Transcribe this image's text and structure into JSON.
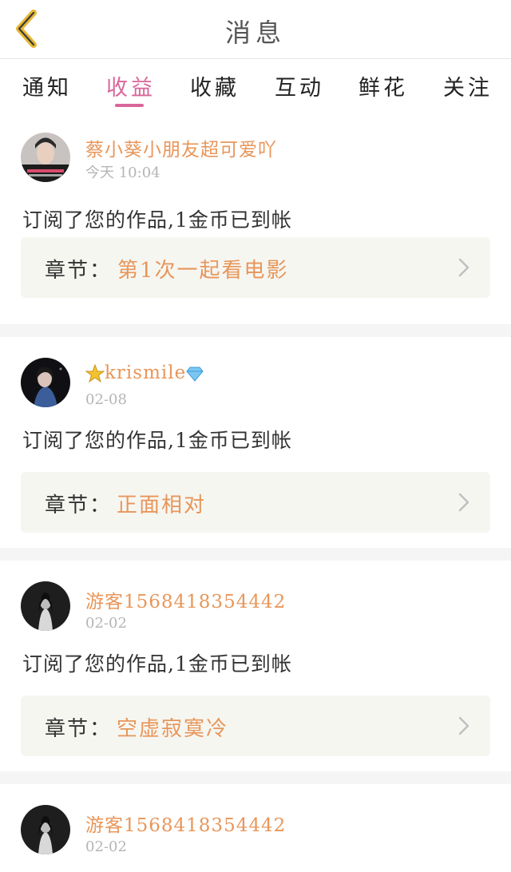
{
  "header": {
    "title": "消息",
    "back_icon": "chevron-left-icon"
  },
  "tabs": [
    {
      "label": "通知",
      "active": false
    },
    {
      "label": "收益",
      "active": true
    },
    {
      "label": "收藏",
      "active": false
    },
    {
      "label": "互动",
      "active": false
    },
    {
      "label": "鲜花",
      "active": false
    },
    {
      "label": "关注",
      "active": false
    }
  ],
  "colors": {
    "accent_pink": "#d9669a",
    "accent_orange": "#e8965a",
    "chapter_bg": "#f6f6f1",
    "separator": "#f5f5f5"
  },
  "messages": [
    {
      "user": "蔡小葵小朋友超可爱吖",
      "time": "今天  10:04",
      "text": "订阅了您的作品,1金币已到帐",
      "chapter_label": "章节：",
      "chapter_title": "第1次一起看电影",
      "badges": []
    },
    {
      "user": "krismile",
      "time": "02-08",
      "text": "订阅了您的作品,1金币已到帐",
      "chapter_label": "章节：",
      "chapter_title": "正面相对",
      "badges": [
        "star-badge-icon",
        "diamond-badge-icon"
      ]
    },
    {
      "user": "游客1568418354442",
      "time": "02-02",
      "text": "订阅了您的作品,1金币已到帐",
      "chapter_label": "章节：",
      "chapter_title": "空虚寂寞冷",
      "badges": []
    },
    {
      "user": "游客1568418354442",
      "time": "02-02",
      "text": "",
      "chapter_label": "",
      "chapter_title": "",
      "badges": []
    }
  ]
}
